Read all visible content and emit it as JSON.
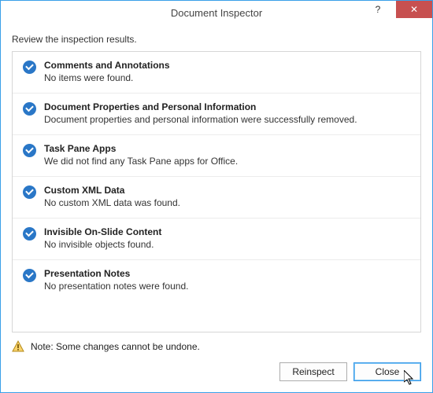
{
  "window": {
    "title": "Document Inspector"
  },
  "instruction": "Review the inspection results.",
  "results": [
    {
      "title": "Comments and Annotations",
      "desc": "No items were found."
    },
    {
      "title": "Document Properties and Personal Information",
      "desc": "Document properties and personal information were successfully removed."
    },
    {
      "title": "Task Pane Apps",
      "desc": "We did not find any Task Pane apps for Office."
    },
    {
      "title": "Custom XML Data",
      "desc": "No custom XML data was found."
    },
    {
      "title": "Invisible On-Slide Content",
      "desc": "No invisible objects found."
    },
    {
      "title": "Presentation Notes",
      "desc": "No presentation notes were found."
    }
  ],
  "note": "Note: Some changes cannot be undone.",
  "buttons": {
    "reinspect": "Reinspect",
    "close": "Close"
  },
  "titlebar": {
    "help": "?",
    "close": "✕"
  }
}
